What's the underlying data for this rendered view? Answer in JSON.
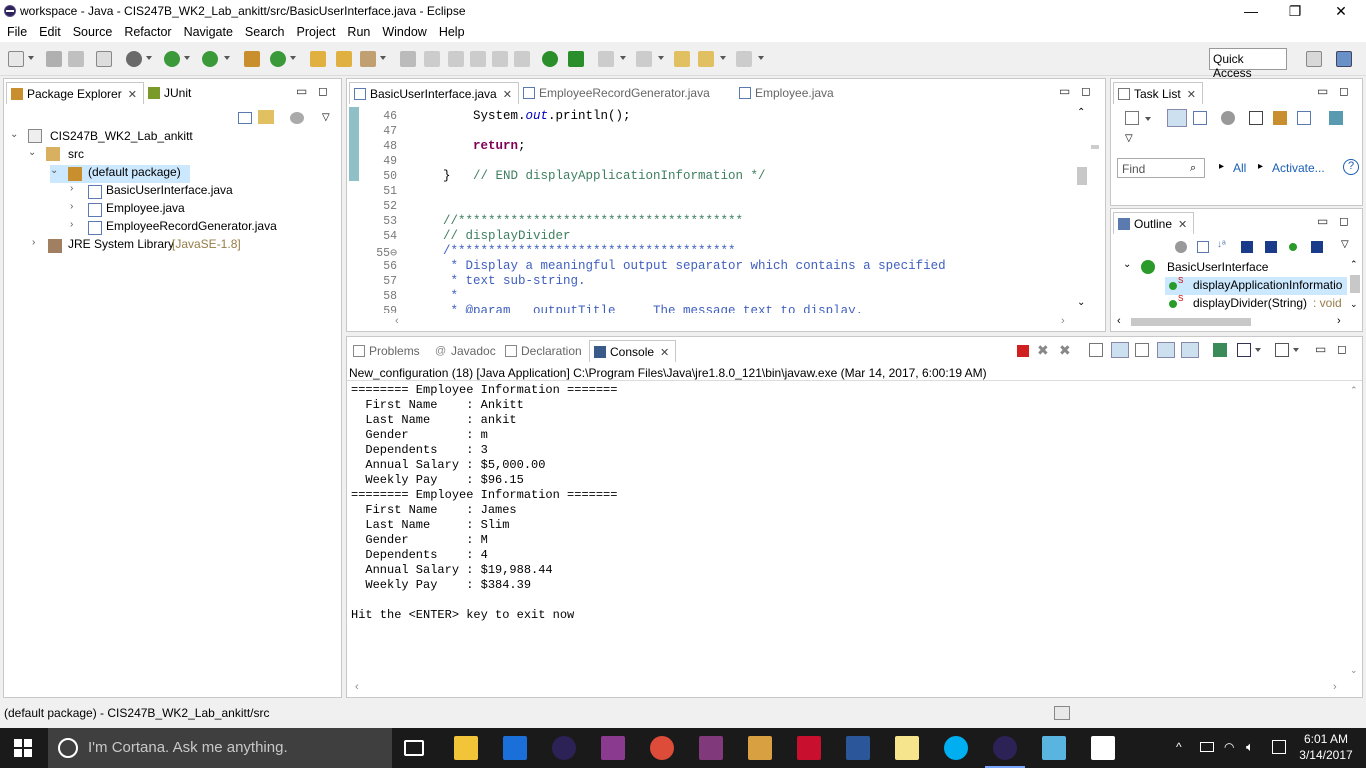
{
  "window": {
    "title": "workspace - Java - CIS247B_WK2_Lab_ankitt/src/BasicUserInterface.java - Eclipse",
    "minimize": "—",
    "restore": "❐",
    "close": "✕"
  },
  "menu": [
    "File",
    "Edit",
    "Source",
    "Refactor",
    "Navigate",
    "Search",
    "Project",
    "Run",
    "Window",
    "Help"
  ],
  "toolbar": {
    "quick_access": "Quick Access"
  },
  "package_explorer": {
    "tabs": [
      {
        "label": "Package Explorer",
        "close": "✕"
      },
      {
        "label": "JUnit"
      }
    ],
    "tree": [
      {
        "label": "CIS247B_WK2_Lab_ankitt",
        "chev": "⌄",
        "icon": "project-icon"
      },
      {
        "label": "src",
        "chev": "⌄",
        "icon": "source-folder-icon"
      },
      {
        "label": "(default package)",
        "chev": "⌄",
        "icon": "package-icon"
      },
      {
        "label": "BasicUserInterface.java",
        "chev": "›",
        "icon": "java-file-icon"
      },
      {
        "label": "Employee.java",
        "chev": "›",
        "icon": "java-file-icon"
      },
      {
        "label": "EmployeeRecordGenerator.java",
        "chev": "›",
        "icon": "java-file-icon"
      },
      {
        "label": "JRE System Library",
        "suffix": "[JavaSE-1.8]",
        "chev": "›",
        "icon": "library-icon"
      }
    ]
  },
  "editor": {
    "tabs": [
      {
        "label": "BasicUserInterface.java",
        "close": "✕"
      },
      {
        "label": "EmployeeRecordGenerator.java"
      },
      {
        "label": "Employee.java"
      }
    ],
    "lines": [
      {
        "n": "46",
        "parts": [
          {
            "t": "        System.",
            "c": ""
          },
          {
            "t": "out",
            "c": "fld"
          },
          {
            "t": ".println();",
            "c": ""
          }
        ]
      },
      {
        "n": "47",
        "parts": [
          {
            "t": "",
            "c": ""
          }
        ]
      },
      {
        "n": "48",
        "parts": [
          {
            "t": "        ",
            "c": ""
          },
          {
            "t": "return",
            "c": "kw"
          },
          {
            "t": ";",
            "c": ""
          }
        ]
      },
      {
        "n": "49",
        "parts": [
          {
            "t": "",
            "c": ""
          }
        ]
      },
      {
        "n": "50",
        "parts": [
          {
            "t": "    }   ",
            "c": ""
          },
          {
            "t": "// END displayApplicationInformation */",
            "c": "cmt"
          }
        ]
      },
      {
        "n": "51",
        "parts": [
          {
            "t": "",
            "c": ""
          }
        ]
      },
      {
        "n": "52",
        "parts": [
          {
            "t": "",
            "c": ""
          }
        ]
      },
      {
        "n": "53",
        "parts": [
          {
            "t": "    //**************************************",
            "c": "cmt"
          }
        ]
      },
      {
        "n": "54",
        "parts": [
          {
            "t": "    // displayDivider",
            "c": "cmt"
          }
        ]
      },
      {
        "n": "55⊖",
        "parts": [
          {
            "t": "    /**************************************",
            "c": "jdoc"
          }
        ]
      },
      {
        "n": "56",
        "parts": [
          {
            "t": "     * Display a meaningful output separator which contains a specified",
            "c": "jdoc"
          }
        ]
      },
      {
        "n": "57",
        "parts": [
          {
            "t": "     * text sub-string.",
            "c": "jdoc"
          }
        ]
      },
      {
        "n": "58",
        "parts": [
          {
            "t": "     *",
            "c": "jdoc"
          }
        ]
      },
      {
        "n": "59",
        "parts": [
          {
            "t": "     * @param   outputTitle     The message text to display.",
            "c": "jdoc"
          }
        ]
      }
    ]
  },
  "task_list": {
    "tab": "Task List",
    "close": "✕",
    "find_placeholder": "Find",
    "all": "All",
    "activate": "Activate..."
  },
  "outline": {
    "tab": "Outline",
    "close": "✕",
    "class_name": "BasicUserInterface",
    "items": [
      {
        "label": "displayApplicationInformatio",
        "suffix": ""
      },
      {
        "label": "displayDivider(String)",
        "suffix": " : void"
      }
    ]
  },
  "bottom_tabs": [
    {
      "label": "Problems"
    },
    {
      "label": "Javadoc"
    },
    {
      "label": "Declaration"
    },
    {
      "label": "Console",
      "close": "✕"
    }
  ],
  "console": {
    "launch": "New_configuration (18) [Java Application] C:\\Program Files\\Java\\jre1.8.0_121\\bin\\javaw.exe (Mar 14, 2017, 6:00:19 AM)",
    "lines": [
      "======== Employee Information =======",
      "  First Name    : Ankitt",
      "  Last Name     : ankit",
      "  Gender        : m",
      "  Dependents    : 3",
      "  Annual Salary : $5,000.00",
      "  Weekly Pay    : $96.15",
      "======== Employee Information =======",
      "  First Name    : James",
      "  Last Name     : Slim",
      "  Gender        : M",
      "  Dependents    : 4",
      "  Annual Salary : $19,988.44",
      "  Weekly Pay    : $384.39",
      "",
      "Hit the <ENTER> key to exit now"
    ]
  },
  "status": "(default package) - CIS247B_WK2_Lab_ankitt/src",
  "taskbar": {
    "cortana": "I'm Cortana. Ask me anything.",
    "time": "6:01 AM",
    "date": "3/14/2017",
    "apps": [
      {
        "name": "task-view",
        "color": "#1a1a1a"
      },
      {
        "name": "file-explorer",
        "color": "#f2c438"
      },
      {
        "name": "edge",
        "color": "#1a6fd8"
      },
      {
        "name": "eclipse",
        "color": "#2c2255"
      },
      {
        "name": "winrar",
        "color": "#8a3b8f"
      },
      {
        "name": "chrome",
        "color": "#dd4b39"
      },
      {
        "name": "onenote",
        "color": "#80397b"
      },
      {
        "name": "paint",
        "color": "#d8a040"
      },
      {
        "name": "acrobat",
        "color": "#c8102e"
      },
      {
        "name": "word",
        "color": "#2b579a"
      },
      {
        "name": "sticky-notes",
        "color": "#f6e58d"
      },
      {
        "name": "skype",
        "color": "#00aff0"
      },
      {
        "name": "eclipse-active",
        "color": "#2c2255"
      },
      {
        "name": "notepad",
        "color": "#5ab4e0"
      },
      {
        "name": "photos",
        "color": "#ffffff"
      }
    ]
  }
}
